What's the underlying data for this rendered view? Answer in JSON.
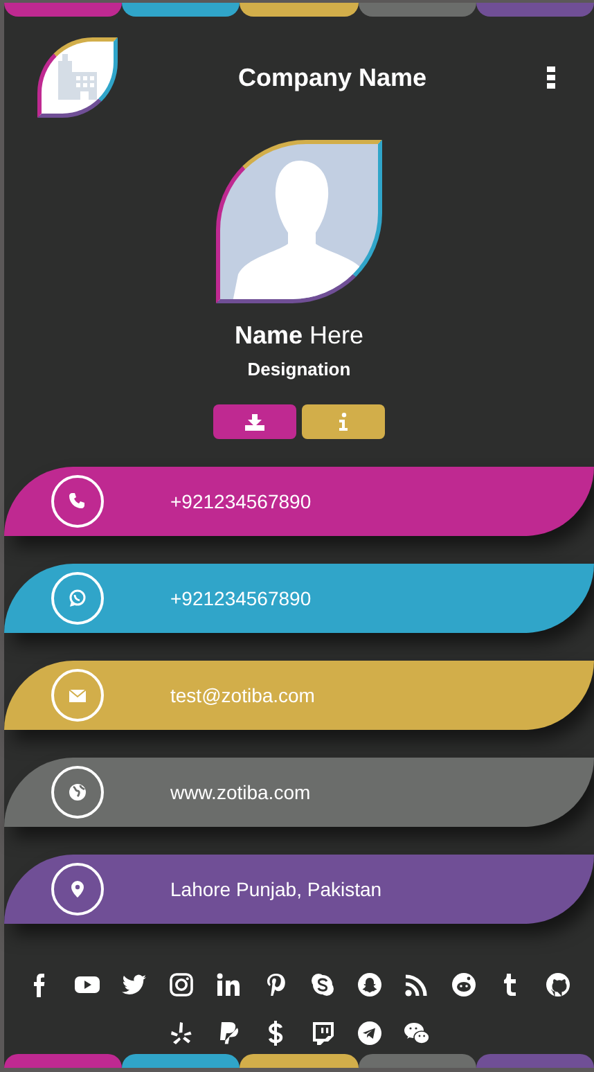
{
  "header": {
    "company_name": "Company Name"
  },
  "profile": {
    "name": "**Name** Here",
    "designation": "Designation"
  },
  "contacts": [
    {
      "kind": "phone",
      "text": "+921234567890",
      "color": "#bf2991"
    },
    {
      "kind": "whatsapp",
      "text": "+921234567890",
      "color": "#30a5c9"
    },
    {
      "kind": "email",
      "text": "test@zotiba.com",
      "color": "#d2ae4a"
    },
    {
      "kind": "website",
      "text": "www.zotiba.com",
      "color": "#6b6d6b"
    },
    {
      "kind": "location",
      "text": "Lahore Punjab, Pakistan",
      "color": "#704f96"
    }
  ]
}
